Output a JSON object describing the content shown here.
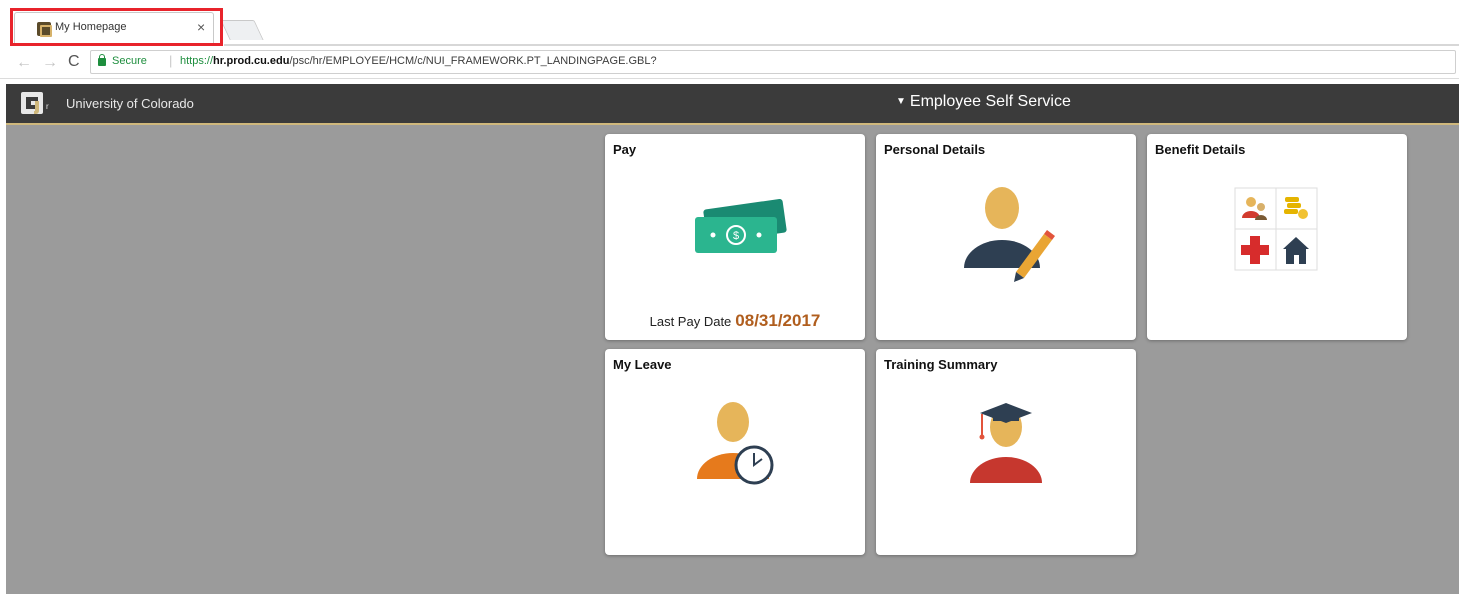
{
  "browser": {
    "tab_title": "My Homepage",
    "tab_close": "×",
    "secure_label": "Secure",
    "url_scheme": "https://",
    "url_host": "hr.prod.cu.edu",
    "url_path": "/psc/hr/EMPLOYEE/HCM/c/NUI_FRAMEWORK.PT_LANDINGPAGE.GBL?",
    "back_glyph": "←",
    "forward_glyph": "→",
    "reload_glyph": "C",
    "highlight_color": "#e8232b"
  },
  "header": {
    "brand": "University of Colorado",
    "homepage_caret": "▼",
    "homepage_name": "Employee Self Service",
    "background": "#3b3b3b",
    "accent": "#cfb87c"
  },
  "tiles": {
    "pay": {
      "title": "Pay",
      "icon": "money-icon",
      "last_pay_label": "Last Pay Date",
      "last_pay_date": "08/31/2017"
    },
    "personal": {
      "title": "Personal Details",
      "icon": "person-edit-icon"
    },
    "benefits": {
      "title": "Benefit Details",
      "icon": "benefits-grid-icon"
    },
    "leave": {
      "title": "My Leave",
      "icon": "person-clock-icon"
    },
    "training": {
      "title": "Training Summary",
      "icon": "graduate-icon"
    }
  },
  "colors": {
    "content_bg": "#9b9b9b",
    "pay_date": "#b05e1e",
    "secure_green": "#1e8e3e"
  }
}
